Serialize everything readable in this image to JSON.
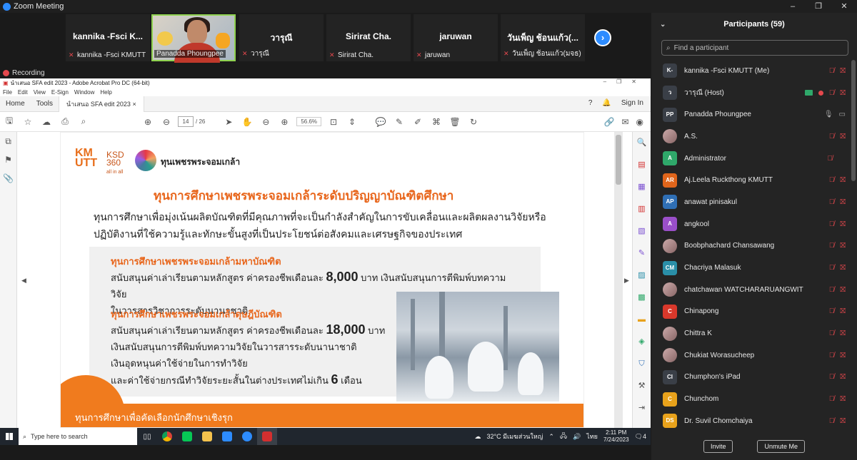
{
  "window": {
    "title": "Zoom Meeting",
    "controls": [
      "–",
      "❐",
      "✕"
    ]
  },
  "gallery": {
    "tiles": [
      {
        "big": "kannika -Fsci K...",
        "small": "kannika -Fsci KMUTT"
      },
      {
        "big": "",
        "small": "Panadda Phoungpee",
        "video": true
      },
      {
        "big": "วารุณี",
        "small": "วารุณี"
      },
      {
        "big": "Sirirat Cha.",
        "small": "Sirirat Cha."
      },
      {
        "big": "jaruwan",
        "small": "jaruwan"
      },
      {
        "big": "วันเพ็ญ ช้อนแก้ว(...",
        "small": "วันเพ็ญ ช้อนแก้ว(มจธ)"
      }
    ],
    "next_label": "›"
  },
  "recording": "Recording",
  "acrobat": {
    "title": "นำเสนอ SFA edit 2023 - Adobe Acrobat Pro DC (64-bit)",
    "menu": [
      "File",
      "Edit",
      "View",
      "E-Sign",
      "Window",
      "Help"
    ],
    "tabs": {
      "home": "Home",
      "tools": "Tools",
      "doc": "นำเสนอ SFA edit 2023",
      "close": "×",
      "signin": "Sign In"
    },
    "page_current": "14",
    "page_total": "/ 26",
    "zoom": "56.6%"
  },
  "slide": {
    "logo_km": "KM\nUTT",
    "logo_ksd": "KSD\n360\nall in all",
    "logo_fund": "ทุนเพชรพระจอมเกล้า",
    "title": "ทุนการศึกษาเพชรพระจอมเกล้าระดับปริญญาบัณฑิตศึกษา",
    "intro": "ทุนการศึกษาเพื่อมุ่งเน้นผลิตบัณฑิตที่มีคุณภาพที่จะเป็นกำลังสำคัญในการขับเคลื่อนและผลิตผลงานวิจัยหรือ ปฏิบัติงานที่ใช้ความรู้และทักษะขั้นสูงที่เป็นประโยชน์ต่อสังคมและเศรษฐกิจของประเทศ",
    "master_head": "ทุนการศึกษาเพชรพระจอมเกล้ามหาบัณฑิต",
    "master_l1a": "สนับสนุนค่าเล่าเรียนตามหลักสูตร ค่าครองชีพเดือนละ",
    "master_num": "8,000",
    "master_l1b": "บาท เงินสนับสนุนการตีพิมพ์บทความวิจัย",
    "master_l2": "ในวารสารวิชาการระดับนานาชาติ",
    "phd_head": "ทุนการศึกษาเพชรพระจอมเกล้าดุษฎีบัณฑิต",
    "phd_l1a": "สนับสนุนค่าเล่าเรียนตามหลักสูตร ค่าครองชีพเดือนละ",
    "phd_num": "18,000",
    "phd_l1b": "บาท",
    "phd_l2": "เงินสนับสนุนการตีพิมพ์บทความวิจัยในวารสารระดับนานาชาติ",
    "phd_l3": "เงินอุดหนุนค่าใช้จ่ายในการทำวิจัย",
    "phd_l4a": "และค่าใช้จ่ายกรณีทำวิจัยระยะสั้นในต่างประเทศไม่เกิน",
    "phd_num2": "6",
    "phd_l4b": "เดือน",
    "banner": "ทุนการศึกษาเพื่อคัดเลือกนักศึกษาเชิงรุก"
  },
  "taskbar": {
    "search_placeholder": "Type here to search",
    "weather": "32°C  มีเมฆส่วนใหญ่",
    "lang": "ไทย",
    "time": "2:11 PM",
    "date": "7/24/2023",
    "notif_count": "4"
  },
  "participants": {
    "header": "Participants (59)",
    "search_placeholder": "Find a participant",
    "list": [
      {
        "initials": "K-",
        "name": "kannika -Fsci KMUTT (Me)",
        "color": "#3a3f47",
        "mic": "off",
        "video": "off"
      },
      {
        "initials": "ว",
        "name": "วารุณี (Host)",
        "color": "#3a3f47",
        "mic": "off",
        "video": "off",
        "share": true
      },
      {
        "initials": "PP",
        "name": "Panadda Phoungpee",
        "color": "#3a3f47",
        "mic": "on",
        "video": "on"
      },
      {
        "initials": "",
        "name": "A.S.",
        "color": "#888888",
        "mic": "off",
        "video": "off",
        "photo": true
      },
      {
        "initials": "A",
        "name": "Administrator",
        "color": "#2fa86a",
        "mic": "off",
        "video": "none"
      },
      {
        "initials": "AR",
        "name": "Aj.Leela Ruckthong KMUTT",
        "color": "#e0651b",
        "mic": "off",
        "video": "off"
      },
      {
        "initials": "AP",
        "name": "anawat pinisakul",
        "color": "#2f6fb5",
        "mic": "off",
        "video": "off"
      },
      {
        "initials": "A",
        "name": "angkool",
        "color": "#9a4fc9",
        "mic": "off",
        "video": "off"
      },
      {
        "initials": "",
        "name": "Boobphachard Chansawang",
        "color": "#888888",
        "mic": "off",
        "video": "off",
        "photo": true
      },
      {
        "initials": "CM",
        "name": "Chacriya Malasuk",
        "color": "#2a8fa8",
        "mic": "off",
        "video": "off"
      },
      {
        "initials": "",
        "name": "chatchawan WATCHARARUANGWIT",
        "color": "#888888",
        "mic": "off",
        "video": "off",
        "photo": true
      },
      {
        "initials": "C",
        "name": "Chinapong",
        "color": "#d9382b",
        "mic": "off",
        "video": "off"
      },
      {
        "initials": "",
        "name": "Chittra K",
        "color": "#888888",
        "mic": "off",
        "video": "off",
        "photo": true
      },
      {
        "initials": "",
        "name": "Chukiat Worasucheep",
        "color": "#888888",
        "mic": "off",
        "video": "off",
        "photo": true
      },
      {
        "initials": "CI",
        "name": "Chumphon's iPad",
        "color": "#3a3f47",
        "mic": "off",
        "video": "off"
      },
      {
        "initials": "C",
        "name": "Chunchom",
        "color": "#e8a21b",
        "mic": "off",
        "video": "off"
      },
      {
        "initials": "DS",
        "name": "Dr. Suvil Chomchaiya",
        "color": "#e8a21b",
        "mic": "off",
        "video": "off"
      }
    ],
    "invite": "Invite",
    "unmute": "Unmute Me"
  }
}
